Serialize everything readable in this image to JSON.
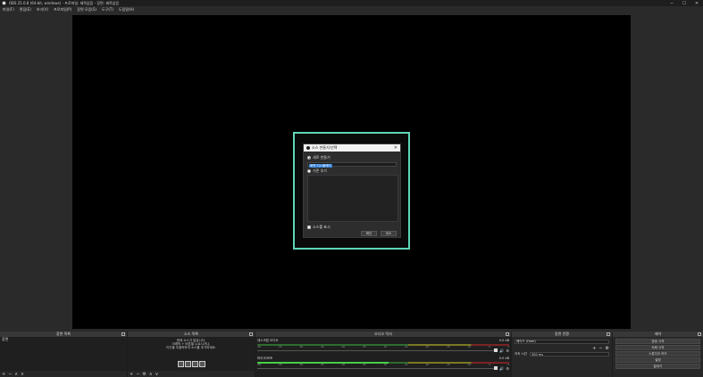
{
  "window": {
    "title": "OBS 25.0.8 (64-bit, windows) - 프로파일: 제목없음 - 장면: 제목없음",
    "controls": {
      "minimize": "─",
      "maximize": "☐",
      "close": "✕"
    }
  },
  "menu": [
    "파일(F)",
    "편집(E)",
    "보기(V)",
    "프로파일(P)",
    "장면 모음(S)",
    "도구(T)",
    "도움말(H)"
  ],
  "dialog": {
    "title": "소스 만들기/선택",
    "close": "✕",
    "option_new": "새로 만들기",
    "name_value": "화면 디스플레이",
    "option_existing": "기존 추가",
    "visible_label": "소스를 표시",
    "ok": "확인",
    "cancel": "취소"
  },
  "docks": {
    "scenes": {
      "title": "장면 목록",
      "items": [
        "장면"
      ],
      "footer": [
        "+",
        "−",
        "∧",
        "∨"
      ]
    },
    "sources": {
      "title": "소스 목록",
      "empty_lines": [
        "현재 소스가 없습니다.",
        "아래의 + 버튼을 누르시거나,",
        "이곳을 우클릭하여 소스를 추가하세요."
      ],
      "footer": [
        "+",
        "−",
        "⚙",
        "∧",
        "∨"
      ]
    },
    "mixer": {
      "title": "오디오 믹서",
      "tracks": [
        {
          "name": "데스크탑 오디오",
          "db": "0.0 dB"
        },
        {
          "name": "마이크/보조",
          "db": "0.0 dB"
        }
      ],
      "ticks": [
        "-60",
        "-55",
        "-50",
        "-45",
        "-40",
        "-35",
        "-30",
        "-25",
        "-20",
        "-15",
        "-10",
        "-5",
        "0"
      ]
    },
    "transitions": {
      "title": "장면 전환",
      "selected": "페이드 (Fade)",
      "duration_label": "지속 시간",
      "duration_value": "300 ms",
      "buttons": [
        "+",
        "−",
        "⚙"
      ]
    },
    "controls": {
      "title": "제어",
      "buttons": [
        "방송 시작",
        "녹화 시작",
        "스튜디오 모드",
        "설정",
        "끝내기"
      ]
    }
  },
  "colors": {
    "highlight": "#5ed6b8",
    "meter_green": "#44d044",
    "accent": "#2f7fd8"
  }
}
